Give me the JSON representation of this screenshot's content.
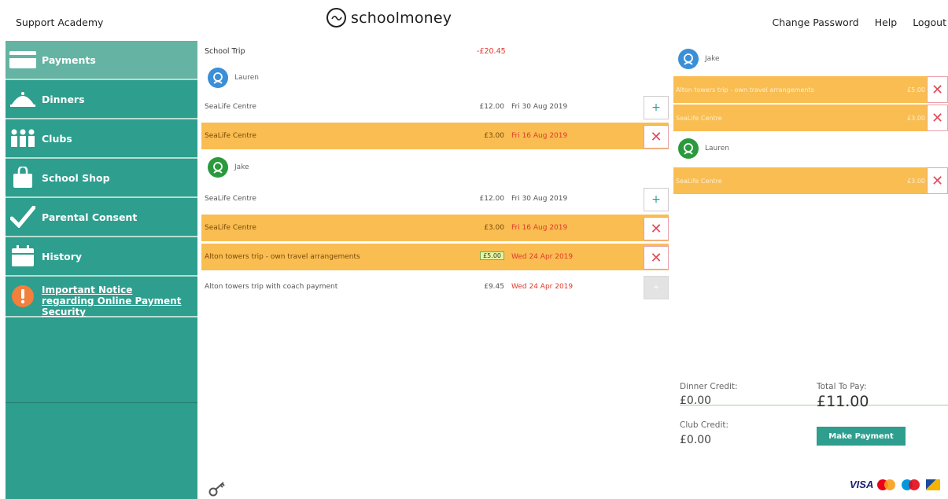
{
  "header": {
    "school_name": "Support Academy",
    "brand": "schoolmoney",
    "links": {
      "change_password": "Change Password",
      "help": "Help",
      "logout": "Logout"
    }
  },
  "sidebar": {
    "items": [
      {
        "label": "Payments",
        "icon": "card-icon",
        "active": true
      },
      {
        "label": "Dinners",
        "icon": "cloche-icon",
        "active": false
      },
      {
        "label": "Clubs",
        "icon": "people-icon",
        "active": false
      },
      {
        "label": "School Shop",
        "icon": "shopping-bag-icon",
        "active": false
      },
      {
        "label": "Parental Consent",
        "icon": "checkmark-icon",
        "active": false
      },
      {
        "label": "History",
        "icon": "calendar-icon",
        "active": false
      },
      {
        "label": "Important Notice regarding Online Payment Security",
        "icon": "alert-icon",
        "active": false
      }
    ]
  },
  "section": {
    "title": "School Trip",
    "total": "-£20.45"
  },
  "children": {
    "lauren": "Lauren",
    "jake": "Jake"
  },
  "items": [
    {
      "name": "SeaLife Centre",
      "price": "£12.00",
      "date": "Fri 30 Aug 2019",
      "highlight": false,
      "action": "add"
    },
    {
      "name": "SeaLife Centre",
      "price": "£3.00",
      "date": "Fri 16 Aug 2019",
      "highlight": true,
      "action": "remove"
    },
    {
      "name": "SeaLife Centre",
      "price": "£12.00",
      "date": "Fri 30 Aug 2019",
      "highlight": false,
      "action": "add"
    },
    {
      "name": "SeaLife Centre",
      "price": "£3.00",
      "date": "Fri 16 Aug 2019",
      "highlight": true,
      "action": "remove"
    },
    {
      "name": "Alton towers trip - own travel arrangements",
      "price": "£5.00",
      "date": "Wed 24 Apr 2019",
      "highlight": true,
      "action": "remove"
    },
    {
      "name": "Alton towers trip with coach payment",
      "price": "£9.45",
      "date": "Wed 24 Apr 2019",
      "highlight": false,
      "action": "add-disabled"
    }
  ],
  "basket": {
    "jake_label": "Jake",
    "lauren_label": "Lauren",
    "jake_items": [
      {
        "name": "Alton towers trip - own travel arrangements",
        "price": "£5.00"
      },
      {
        "name": "SeaLife Centre",
        "price": "£3.00"
      }
    ],
    "lauren_items": [
      {
        "name": "SeaLife Centre",
        "price": "£3.00"
      }
    ]
  },
  "totals": {
    "dinner_credit_label": "Dinner Credit:",
    "dinner_credit_value": "£0.00",
    "club_credit_label": "Club Credit:",
    "club_credit_value": "£0.00",
    "total_label": "Total To Pay:",
    "total_value": "£11.00",
    "make_payment": "Make Payment"
  },
  "cards": {
    "visa": "VISA"
  },
  "symbols": {
    "plus": "+",
    "cross": "✕"
  },
  "colors": {
    "sidebar": "#2e9e8e",
    "active": "#64b3a3",
    "highlight": "#f9bd52",
    "negative": "#e0392b"
  }
}
